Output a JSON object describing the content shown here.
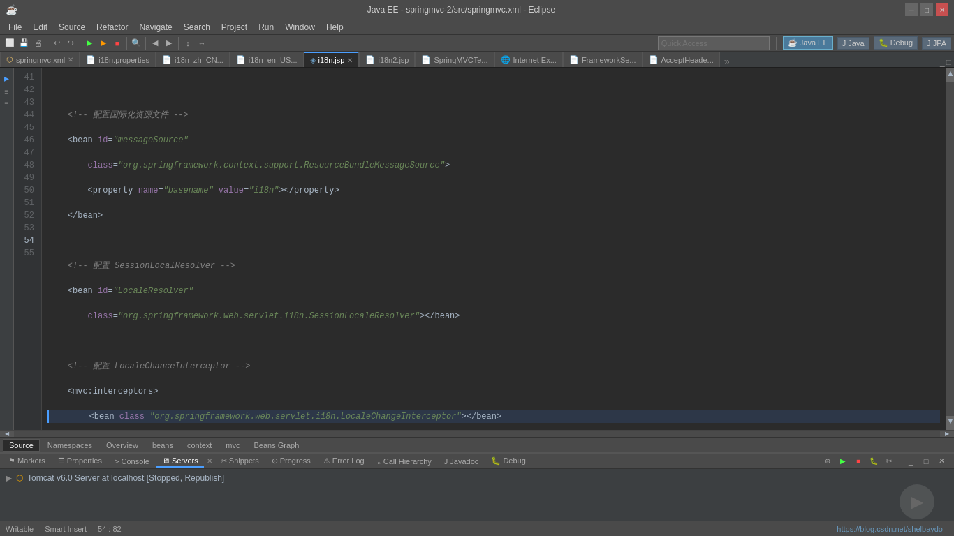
{
  "titleBar": {
    "title": "Java EE - springmvc-2/src/springmvc.xml - Eclipse",
    "btnMin": "─",
    "btnMax": "□",
    "btnClose": "✕"
  },
  "menuBar": {
    "items": [
      "File",
      "Edit",
      "Source",
      "Refactor",
      "Navigate",
      "Search",
      "Project",
      "Run",
      "Window",
      "Help"
    ]
  },
  "quickAccess": {
    "placeholder": "Quick Access"
  },
  "perspectives": [
    {
      "label": "Java EE",
      "active": true,
      "icon": "☕"
    },
    {
      "label": "Java",
      "active": false,
      "icon": "J"
    },
    {
      "label": "Debug",
      "active": false,
      "icon": "🐛"
    },
    {
      "label": "JPA",
      "active": false,
      "icon": "J"
    }
  ],
  "tabs": [
    {
      "id": "springmvc-xml",
      "label": "springmvc.xml",
      "active": false,
      "closeable": true,
      "icon": "📄"
    },
    {
      "id": "i18n-properties",
      "label": "i18n.properties",
      "active": false,
      "closeable": false,
      "icon": "📄"
    },
    {
      "id": "i18n-zh",
      "label": "i18n_zh_CN...",
      "active": false,
      "closeable": false,
      "icon": "📄"
    },
    {
      "id": "i18n-en",
      "label": "i18n_en_US...",
      "active": false,
      "closeable": false,
      "icon": "📄"
    },
    {
      "id": "i18njsp",
      "label": "i18n.jsp",
      "active": true,
      "closeable": true,
      "icon": "📄"
    },
    {
      "id": "i18n2jsp",
      "label": "i18n2.jsp",
      "active": false,
      "closeable": false,
      "icon": "📄"
    },
    {
      "id": "springmvcte",
      "label": "SpringMVCTe...",
      "active": false,
      "closeable": false,
      "icon": "📄"
    },
    {
      "id": "internetex",
      "label": "Internet Ex...",
      "active": false,
      "closeable": false,
      "icon": "🌐"
    },
    {
      "id": "frameworkse",
      "label": "FrameworkSe...",
      "active": false,
      "closeable": false,
      "icon": "📄"
    },
    {
      "id": "acceptheade",
      "label": "AcceptHeade...",
      "active": false,
      "closeable": false,
      "icon": "📄"
    }
  ],
  "codeLines": [
    {
      "num": 41,
      "content": "",
      "type": "blank"
    },
    {
      "num": 42,
      "content": "    <!-- 配置国际化资源文件 -->",
      "type": "comment"
    },
    {
      "num": 43,
      "content": "    <bean id=\"messageSource\"",
      "type": "tag-open",
      "parts": [
        {
          "t": "    ",
          "c": "plain"
        },
        {
          "t": "<bean ",
          "c": "bracket"
        },
        {
          "t": "id",
          "c": "attr"
        },
        {
          "t": "=",
          "c": "plain"
        },
        {
          "t": "\"messageSource\"",
          "c": "value"
        }
      ]
    },
    {
      "num": 44,
      "content": "        class=\"org.springframework.context.support.ResourceBundleMessageSource\">",
      "type": "tag-attr",
      "parts": [
        {
          "t": "        ",
          "c": "plain"
        },
        {
          "t": "class",
          "c": "attr"
        },
        {
          "t": "=",
          "c": "plain"
        },
        {
          "t": "\"org.springframework.context.support.ResourceBundleMessageSource\"",
          "c": "value"
        },
        {
          "t": ">",
          "c": "bracket"
        }
      ]
    },
    {
      "num": 45,
      "content": "        <property name=\"basename\" value=\"i18n\"></property>",
      "type": "tag",
      "parts": [
        {
          "t": "        ",
          "c": "plain"
        },
        {
          "t": "<property ",
          "c": "bracket"
        },
        {
          "t": "name",
          "c": "attr"
        },
        {
          "t": "=",
          "c": "plain"
        },
        {
          "t": "\"basename\"",
          "c": "value"
        },
        {
          "t": " ",
          "c": "plain"
        },
        {
          "t": "value",
          "c": "attr"
        },
        {
          "t": "=",
          "c": "plain"
        },
        {
          "t": "\"i18n\"",
          "c": "value"
        },
        {
          "t": "></property>",
          "c": "bracket"
        }
      ]
    },
    {
      "num": 46,
      "content": "    </bean>",
      "type": "tag-close",
      "parts": [
        {
          "t": "    ",
          "c": "plain"
        },
        {
          "t": "</bean>",
          "c": "bracket"
        }
      ]
    },
    {
      "num": 47,
      "content": "",
      "type": "blank"
    },
    {
      "num": 48,
      "content": "    <!-- 配置 SessionLocalResolver -->",
      "type": "comment"
    },
    {
      "num": 49,
      "content": "    <bean id=\"LocaleResolver\"",
      "type": "tag",
      "parts": [
        {
          "t": "    ",
          "c": "plain"
        },
        {
          "t": "<bean ",
          "c": "bracket"
        },
        {
          "t": "id",
          "c": "attr"
        },
        {
          "t": "=",
          "c": "plain"
        },
        {
          "t": "\"LocaleResolver\"",
          "c": "value"
        }
      ]
    },
    {
      "num": 50,
      "content": "        class=\"org.springframework.web.servlet.i18n.SessionLocaleResolver\"></bean>",
      "type": "tag",
      "parts": [
        {
          "t": "        ",
          "c": "plain"
        },
        {
          "t": "class",
          "c": "attr"
        },
        {
          "t": "=",
          "c": "plain"
        },
        {
          "t": "\"org.springframework.web.servlet.i18n.SessionLocaleResolver\"",
          "c": "value"
        },
        {
          "t": "></bean>",
          "c": "bracket"
        }
      ]
    },
    {
      "num": 51,
      "content": "",
      "type": "blank"
    },
    {
      "num": 52,
      "content": "    <!-- 配置 LocaleChanceInterceptor -->",
      "type": "comment"
    },
    {
      "num": 53,
      "content": "    <mvc:interceptors>",
      "type": "tag",
      "parts": [
        {
          "t": "    ",
          "c": "plain"
        },
        {
          "t": "<mvc:interceptors>",
          "c": "bracket"
        }
      ]
    },
    {
      "num": 54,
      "content": "        <bean class=\"org.springframework.web.servlet.i18n.LocaleChangeInterceptor\"></bean>",
      "type": "tag-active",
      "parts": [
        {
          "t": "        ",
          "c": "plain"
        },
        {
          "t": "<bean ",
          "c": "bracket"
        },
        {
          "t": "class",
          "c": "attr"
        },
        {
          "t": "=",
          "c": "plain"
        },
        {
          "t": "\"org.springframework.web.servlet.i18n.LocaleChangeInterceptor\"",
          "c": "value"
        },
        {
          "t": "></bean>",
          "c": "bracket"
        }
      ]
    },
    {
      "num": 55,
      "content": "    </mvc:interceptors>",
      "type": "tag",
      "parts": [
        {
          "t": "    ",
          "c": "plain"
        },
        {
          "t": "</mvc:interceptors>",
          "c": "bracket"
        }
      ]
    }
  ],
  "bottomTabs": [
    {
      "label": "Source",
      "active": true
    },
    {
      "label": "Namespaces",
      "active": false
    },
    {
      "label": "Overview",
      "active": false
    },
    {
      "label": "beans",
      "active": false
    },
    {
      "label": "context",
      "active": false
    },
    {
      "label": "mvc",
      "active": false
    },
    {
      "label": "Beans Graph",
      "active": false
    }
  ],
  "panelTabs": [
    {
      "label": "Markers",
      "active": false,
      "icon": "⚑"
    },
    {
      "label": "Properties",
      "active": false,
      "icon": "☰"
    },
    {
      "label": "Console",
      "active": false,
      "icon": ">"
    },
    {
      "label": "Servers",
      "active": true,
      "icon": "🖥"
    },
    {
      "label": "Snippets",
      "active": false,
      "icon": "✂"
    },
    {
      "label": "Progress",
      "active": false,
      "icon": "⊙"
    },
    {
      "label": "Error Log",
      "active": false,
      "icon": "⚠"
    },
    {
      "label": "Call Hierarchy",
      "active": false,
      "icon": "⫰"
    },
    {
      "label": "Javadoc",
      "active": false,
      "icon": "J"
    },
    {
      "label": "Debug",
      "active": false,
      "icon": "🐛"
    }
  ],
  "serverRow": {
    "label": "Tomcat v6.0 Server at localhost  [Stopped, Republish]"
  },
  "statusBar": {
    "writable": "Writable",
    "insertMode": "Smart Insert",
    "position": "54 : 82"
  },
  "urlBar": "https://blog.csdn.net/shelbaydo"
}
